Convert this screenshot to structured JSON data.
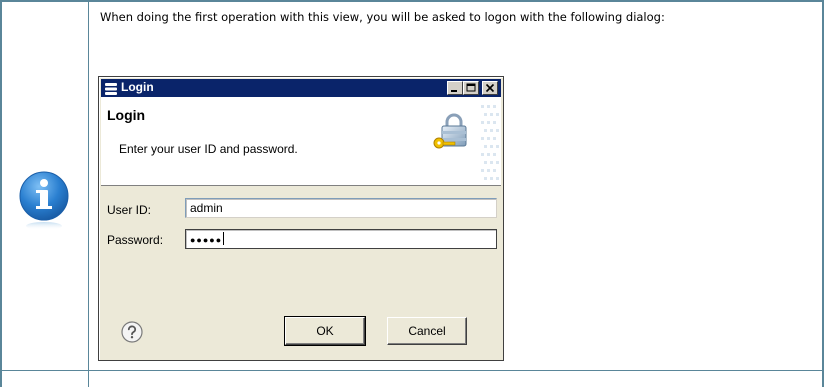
{
  "intro_text": "When doing the first operation with this view, you will be asked to logon with the following dialog:",
  "dialog": {
    "window_title": "Login",
    "header_title": "Login",
    "header_description": "Enter your user ID and password.",
    "fields": {
      "user_id": {
        "label": "User ID:",
        "value": "admin"
      },
      "password": {
        "label": "Password:",
        "value": "●●●●●"
      }
    },
    "buttons": {
      "ok": "OK",
      "cancel": "Cancel"
    },
    "icons": {
      "app": "database-icon",
      "header": "lock-key-icon",
      "help": "help-icon"
    }
  },
  "colors": {
    "frame_border": "#5a8699",
    "titlebar": "#0a246a",
    "dialog_bg": "#ece9d8",
    "info_icon": "#2a7fd0"
  }
}
